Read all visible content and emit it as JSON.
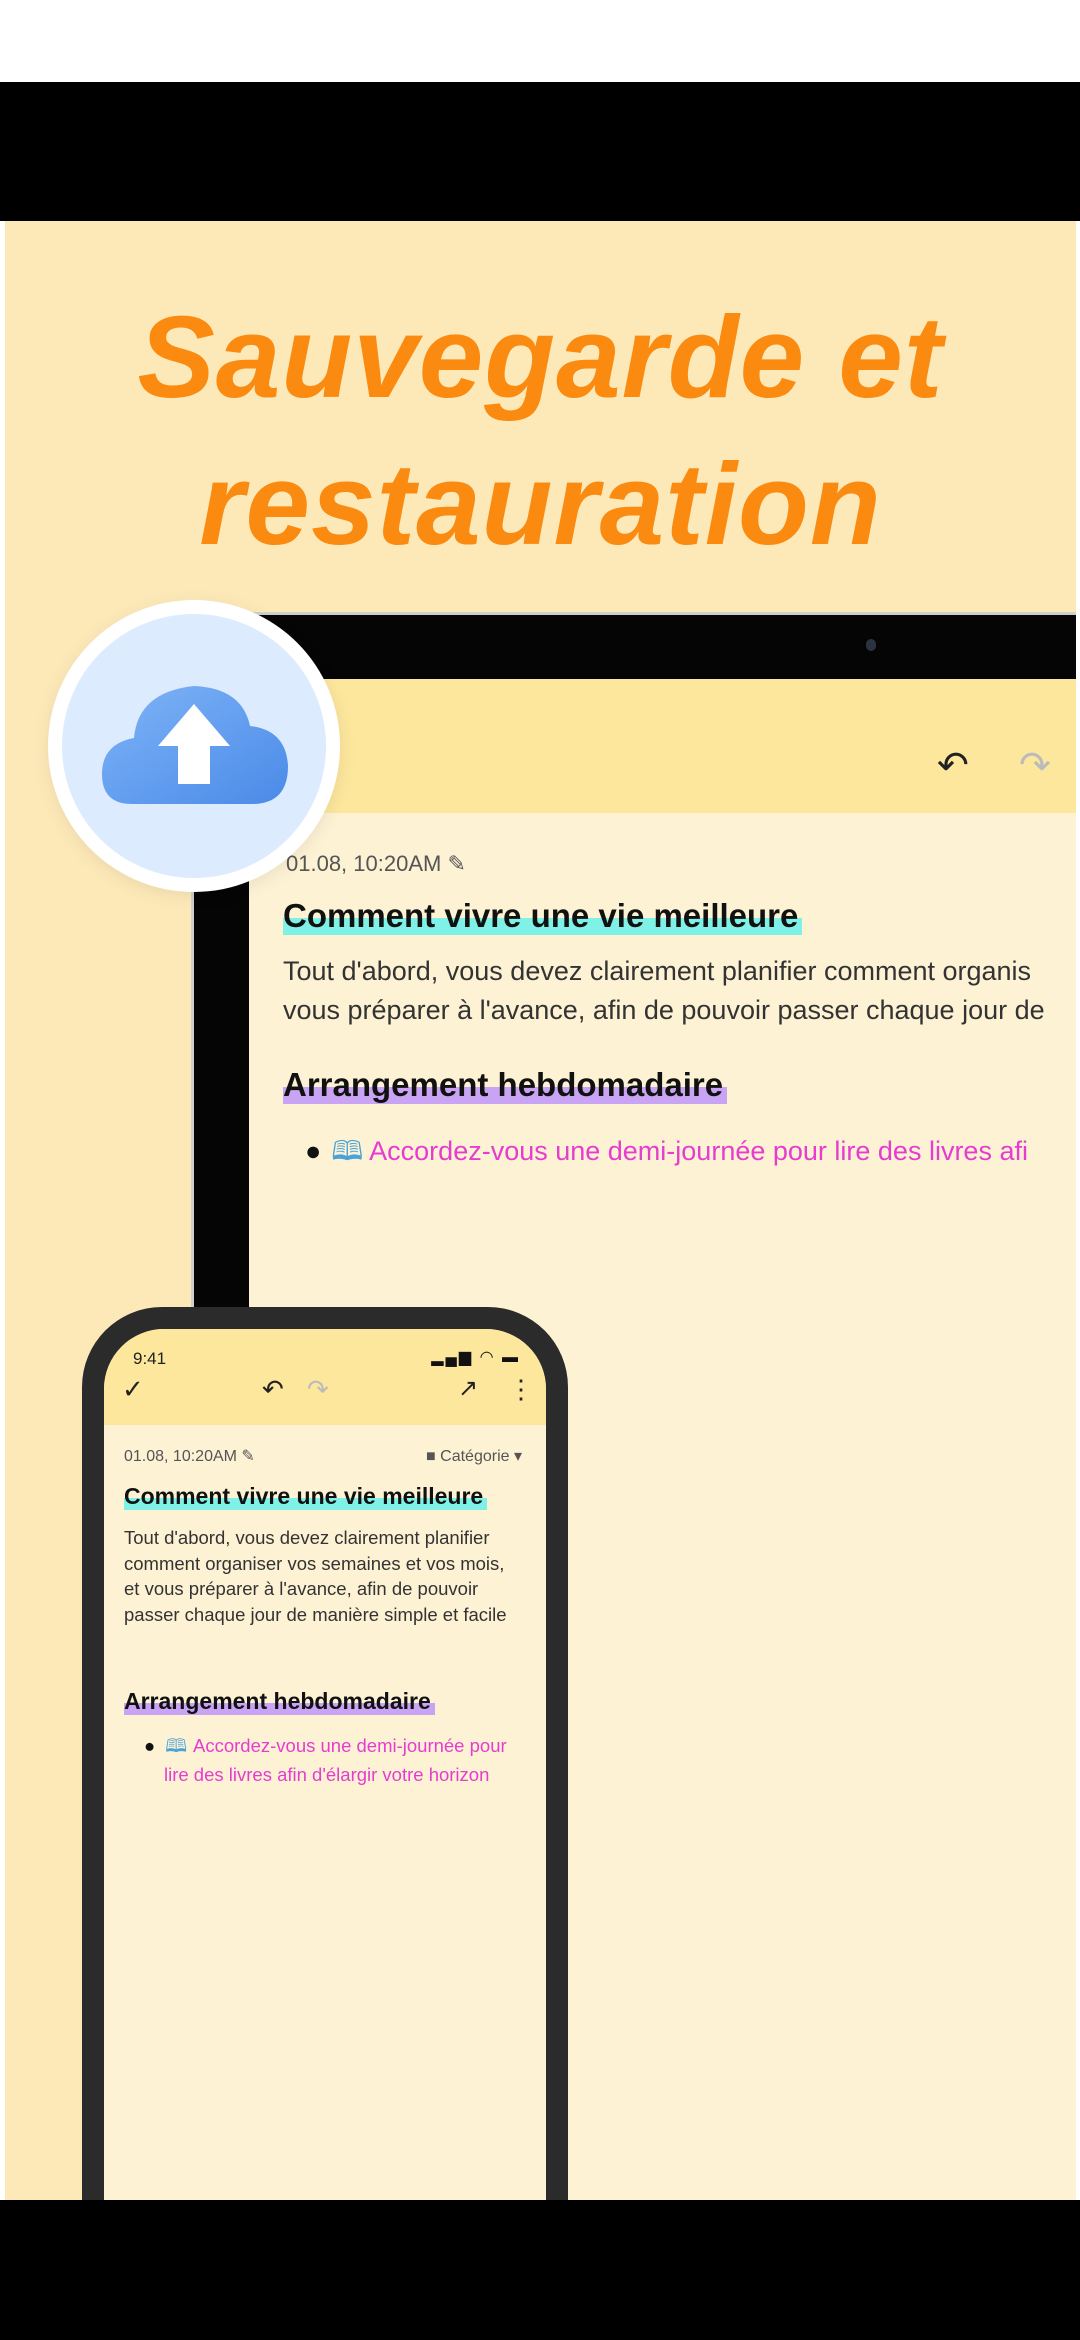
{
  "promo": {
    "title_line1": "Sauvegarde et",
    "title_line2": "restauration",
    "accent_color": "#fb8a10",
    "badge_icon": "cloud-upload-icon"
  },
  "tablet": {
    "toolbar": {
      "undo_icon": "undo-icon",
      "redo_icon": "redo-icon"
    },
    "date": "01.08, 10:20AM",
    "heading1": "Comment vivre une vie meilleure",
    "paragraph_lines": [
      "Tout d'abord, vous devez clairement planifier comment organis",
      "vous préparer à l'avance, afin de pouvoir passer chaque jour de"
    ],
    "heading2": "Arrangement hebdomadaire",
    "bullet": "Accordez-vous une demi-journée pour lire des livres afi"
  },
  "phone": {
    "status_time": "9:41",
    "status_icons": "signal-wifi-battery",
    "date": "01.08, 10:20AM",
    "category": "Catégorie",
    "heading1": "Comment vivre une vie meilleure",
    "paragraph": "Tout d'abord, vous devez clairement planifier comment organiser vos semaines et vos mois, et vous préparer à l'avance, afin de pouvoir passer chaque jour de manière simple et facile",
    "heading2": "Arrangement hebdomadaire",
    "bullet": "Accordez-vous une demi-journée pour lire des livres afin d'élargir votre horizon"
  },
  "colors": {
    "background": "#fde9b8",
    "header": "#fde79d",
    "note": "#fdf2d4",
    "heading1_highlight": "#7ff1e6",
    "heading2_highlight": "#c9a4f5",
    "bullet_text": "#e63ccf"
  }
}
